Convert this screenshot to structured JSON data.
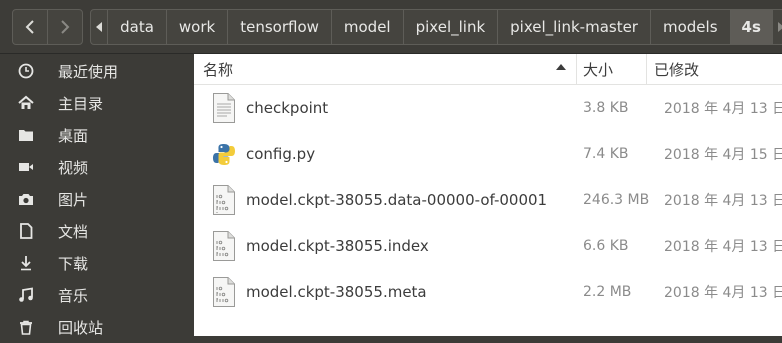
{
  "breadcrumbs": [
    "data",
    "work",
    "tensorflow",
    "model",
    "pixel_link",
    "pixel_link-master",
    "models",
    "4s"
  ],
  "sidebar": {
    "items": [
      {
        "label": "最近使用",
        "icon": "clock-icon"
      },
      {
        "label": "主目录",
        "icon": "home-icon"
      },
      {
        "label": "桌面",
        "icon": "folder-icon"
      },
      {
        "label": "视频",
        "icon": "video-icon"
      },
      {
        "label": "图片",
        "icon": "camera-icon"
      },
      {
        "label": "文档",
        "icon": "document-icon"
      },
      {
        "label": "下载",
        "icon": "download-icon"
      },
      {
        "label": "音乐",
        "icon": "music-icon"
      },
      {
        "label": "回收站",
        "icon": "trash-icon"
      }
    ]
  },
  "columns": {
    "name": "名称",
    "size": "大小",
    "modified": "已修改"
  },
  "files": [
    {
      "name": "checkpoint",
      "size": "3.8 KB",
      "modified": "2018 年 4月 13 日",
      "icon": "text-file-icon"
    },
    {
      "name": "config.py",
      "size": "7.4 KB",
      "modified": "2018 年 4月 15 日",
      "icon": "python-file-icon"
    },
    {
      "name": "model.ckpt-38055.data-00000-of-00001",
      "size": "246.3 MB",
      "modified": "2018 年 4月 13 日",
      "icon": "binary-file-icon"
    },
    {
      "name": "model.ckpt-38055.index",
      "size": "6.6 KB",
      "modified": "2018 年 4月 13 日",
      "icon": "binary-file-icon"
    },
    {
      "name": "model.ckpt-38055.meta",
      "size": "2.2 MB",
      "modified": "2018 年 4月 13 日",
      "icon": "binary-file-icon"
    }
  ],
  "colors": {
    "sidebar": "#3c3b37",
    "active_crumb": "#5e5c57",
    "list_bg": "#ffffff"
  }
}
